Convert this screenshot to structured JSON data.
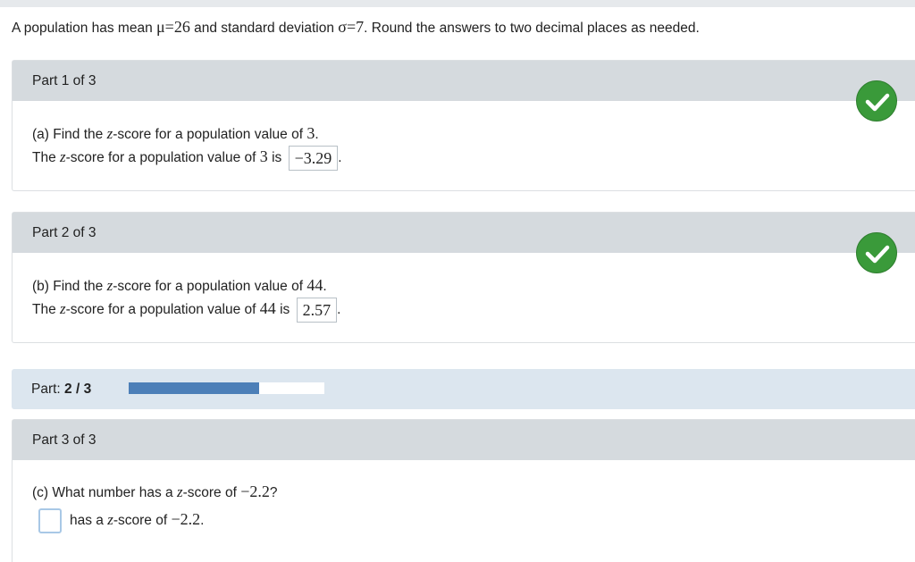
{
  "problem": {
    "prefix": "A population has mean ",
    "mu_expr": "μ=26",
    "mid": " and standard deviation ",
    "sigma_expr": "σ=7",
    "suffix": ". Round the answers to two decimal places as needed."
  },
  "parts": [
    {
      "header": "Part 1 of 3",
      "question_prefix": "(a) Find the ",
      "z": "z",
      "question_mid": "-score for a population value of ",
      "question_value": "3",
      "question_end": ".",
      "answer_prefix": "The ",
      "answer_mid": "-score for a population value of ",
      "answer_value_of": "3",
      "answer_is": " is",
      "answer": "−3.29",
      "answer_end": ".",
      "status": "correct"
    },
    {
      "header": "Part 2 of 3",
      "question_prefix": "(b) Find the ",
      "z": "z",
      "question_mid": "-score for a population value of ",
      "question_value": "44",
      "question_end": ".",
      "answer_prefix": "The ",
      "answer_mid": "-score for a population value of ",
      "answer_value_of": "44",
      "answer_is": " is",
      "answer": "2.57",
      "answer_end": ".",
      "status": "correct"
    },
    {
      "header": "Part 3 of 3",
      "question_prefix": "(c) What number has a ",
      "z": "z",
      "question_mid": "-score of ",
      "question_value": "−2.2",
      "question_end": "?",
      "answer_input_value": "",
      "answer_text_prefix": "has a ",
      "answer_text_mid": "-score of ",
      "answer_text_value": "−2.2",
      "answer_end": "."
    }
  ],
  "progress": {
    "label": "Part: ",
    "value": "2 / 3",
    "fraction": 0.667
  },
  "colors": {
    "check": "#3a9a3a",
    "progress_fill": "#4c7fb8"
  }
}
